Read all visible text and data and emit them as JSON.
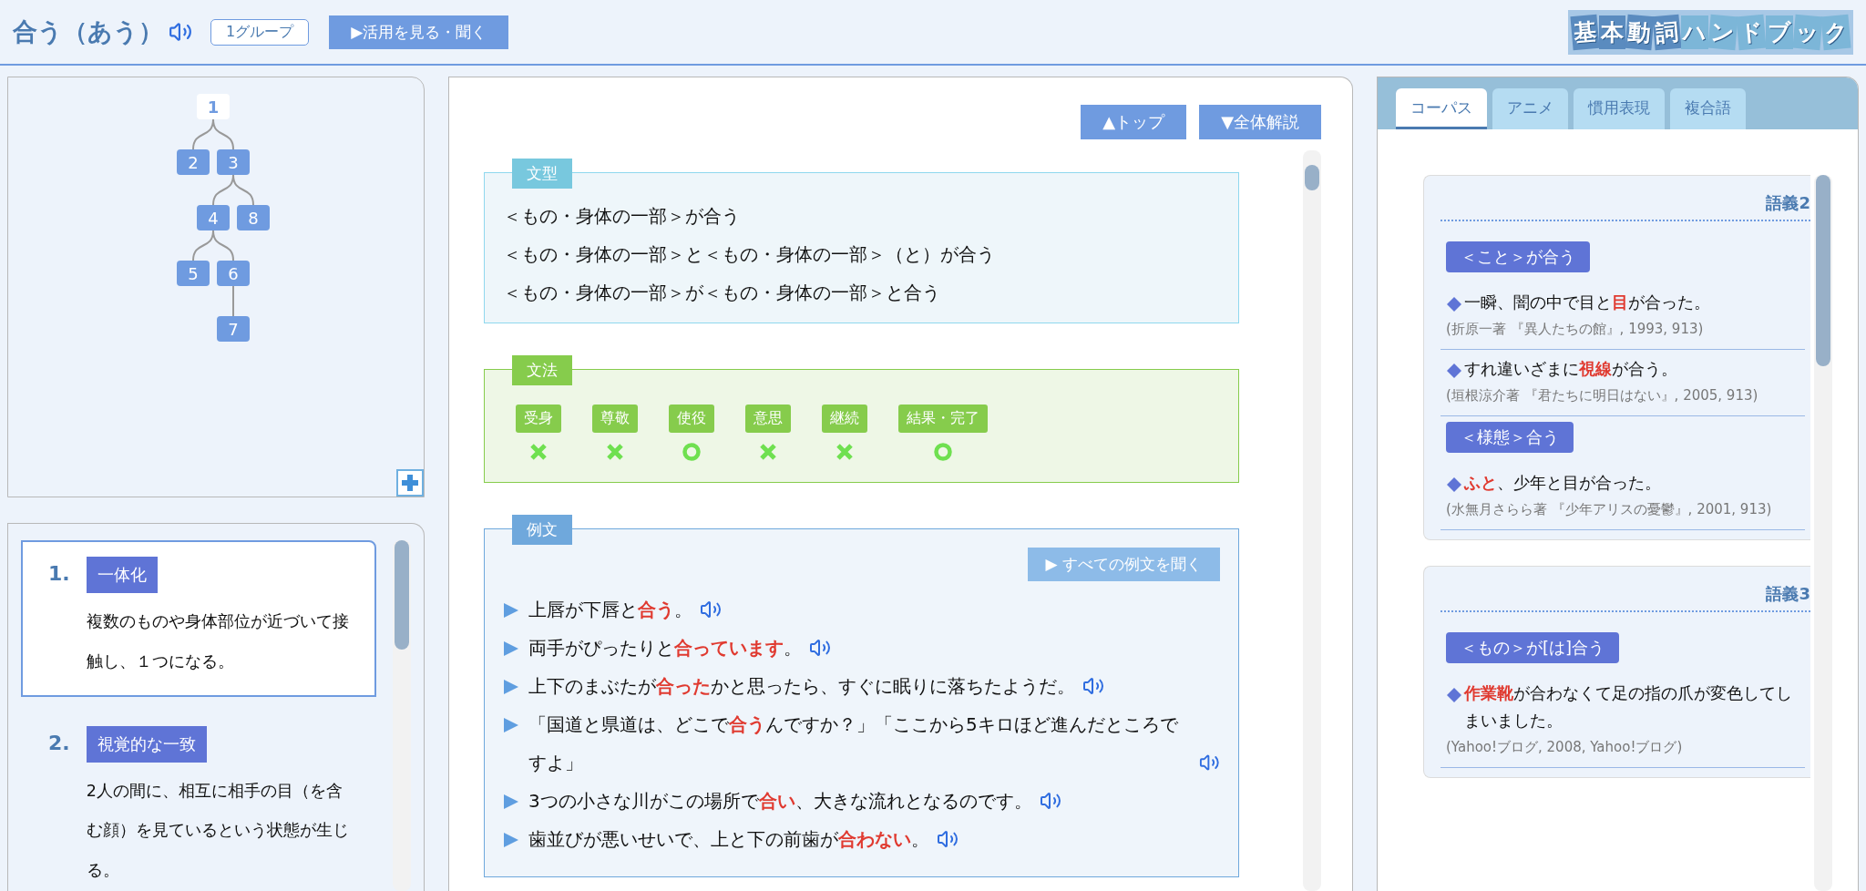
{
  "header": {
    "title": "合う（あう）",
    "group": "1グループ",
    "conjugation_button": "▶活用を見る・聞く",
    "logo": "基本動詞ハンドブック"
  },
  "sense_tree": {
    "nodes": [
      {
        "label": "1",
        "selected": true,
        "children": [
          {
            "label": "2",
            "selected": false
          },
          {
            "label": "3",
            "selected": false,
            "children": [
              {
                "label": "4",
                "selected": false,
                "children": [
                  {
                    "label": "5",
                    "selected": false
                  },
                  {
                    "label": "6",
                    "selected": false,
                    "children": [
                      {
                        "label": "7",
                        "selected": false
                      }
                    ]
                  }
                ]
              },
              {
                "label": "8",
                "selected": false
              }
            ]
          }
        ]
      }
    ]
  },
  "senses": [
    {
      "number": "1.",
      "label": "一体化",
      "description": "複数のものや身体部位が近づいて接触し、１つになる。",
      "selected": true
    },
    {
      "number": "2.",
      "label": "視覚的な一致",
      "description": "2人の間に、相互に相手の目（を含む顔）を見ているという状態が生じる。",
      "selected": false
    }
  ],
  "nav_buttons": [
    "▲トップ",
    "▼全体解説"
  ],
  "sentence_patterns": {
    "heading": "文型",
    "lines": [
      "＜もの・身体の一部＞が合う",
      "＜もの・身体の一部＞と＜もの・身体の一部＞（と）が合う",
      "＜もの・身体の一部＞が＜もの・身体の一部＞と合う"
    ]
  },
  "grammar": {
    "heading": "文法",
    "items": [
      {
        "label": "受身",
        "allowed": false
      },
      {
        "label": "尊敬",
        "allowed": false
      },
      {
        "label": "使役",
        "allowed": true
      },
      {
        "label": "意思",
        "allowed": false
      },
      {
        "label": "継続",
        "allowed": false
      },
      {
        "label": "結果・完了",
        "allowed": true
      }
    ]
  },
  "examples": {
    "heading": "例文",
    "play_all": "▶ すべての例文を聞く",
    "sentences": [
      "上唇が下唇と**合う**。",
      "両手がぴったりと**合っています**。",
      "上下のまぶたが**合った**かと思ったら、すぐに眠りに落ちたようだ。",
      "「国道と県道は、どこで**合う**んですか？」「ここから5キロほど進んだところですよ」",
      "3つの小さな川がこの場所で**合い**、大きな流れとなるのです。",
      "歯並びが悪いせいで、上と下の前歯が**合わない**。"
    ]
  },
  "corpus": {
    "tabs": [
      {
        "label": "コーパス",
        "selected": true
      },
      {
        "label": "アニメ",
        "selected": false
      },
      {
        "label": "慣用表現",
        "selected": false
      },
      {
        "label": "複合語",
        "selected": false
      }
    ],
    "senses": [
      {
        "heading": "語義2",
        "patterns": [
          {
            "label": "＜こと＞が合う",
            "examples": [
              {
                "text": "一瞬、闇の中で目と**目**が合った。",
                "source": "(折原一著 『異人たちの館』, 1993, 913)"
              },
              {
                "text": "すれ違いざまに**視線**が合う。",
                "source": "(垣根涼介著 『君たちに明日はない』, 2005, 913)"
              }
            ]
          },
          {
            "label": "＜様態＞合う",
            "examples": [
              {
                "text": "**ふと**、少年と目が合った。",
                "source": "(水無月さらら著 『少年アリスの憂鬱』, 2001, 913)"
              }
            ]
          }
        ]
      },
      {
        "heading": "語義3",
        "patterns": [
          {
            "label": "＜もの＞が[は]合う",
            "examples": [
              {
                "text": "**作業靴**が合わなくて足の指の爪が変色してしまいました。",
                "source": "(Yahoo!ブログ, 2008, Yahoo!ブログ)"
              }
            ]
          }
        ]
      }
    ]
  }
}
